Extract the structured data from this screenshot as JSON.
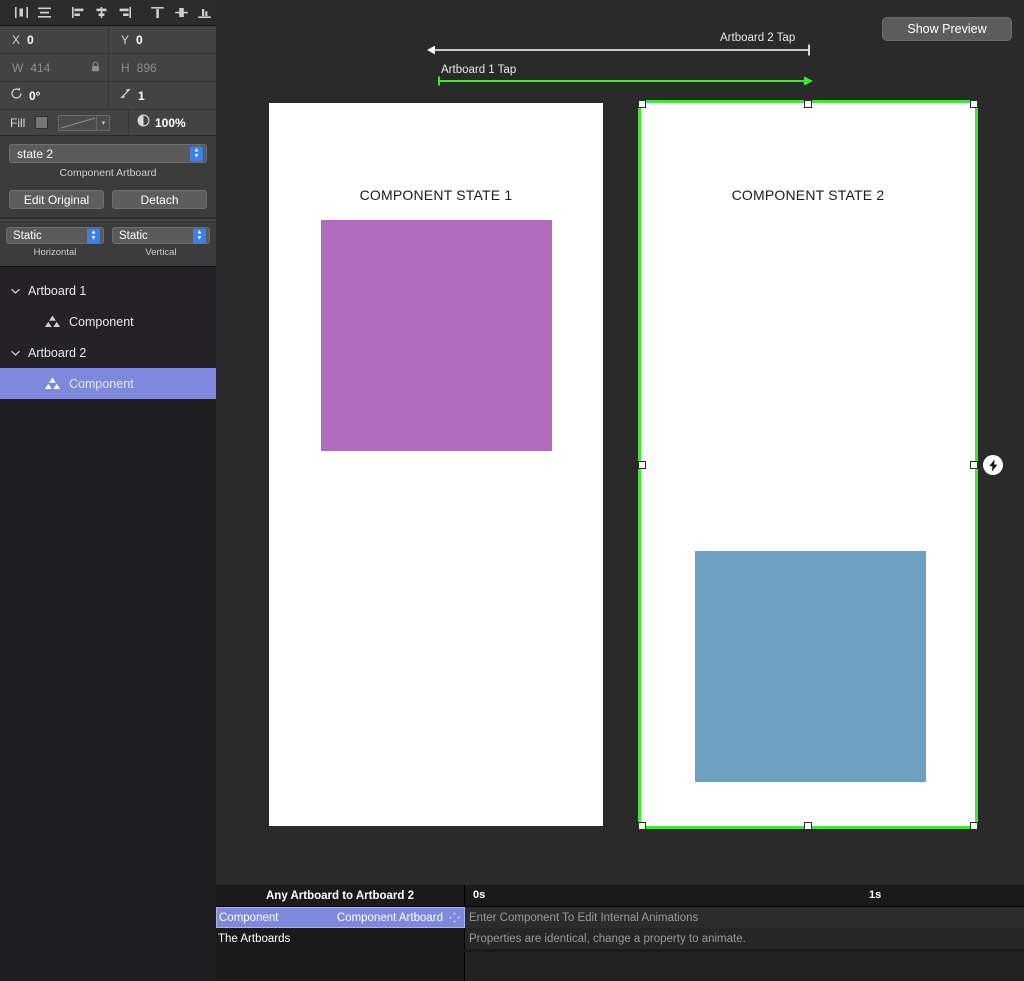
{
  "inspector": {
    "align_tools": [
      {
        "name": "distribute-horizontally-icon",
        "label": "Distribute Horizontally"
      },
      {
        "name": "distribute-vertically-icon",
        "label": "Distribute Vertically"
      },
      {
        "name": "align-left-icon",
        "label": "Align Left"
      },
      {
        "name": "align-center-horizontal-icon",
        "label": "Align Center Horizontal"
      },
      {
        "name": "align-right-icon",
        "label": "Align Right"
      },
      {
        "name": "align-top-icon",
        "label": "Align Top"
      },
      {
        "name": "align-center-vertical-icon",
        "label": "Align Center Vertical"
      },
      {
        "name": "align-bottom-icon",
        "label": "Align Bottom"
      }
    ],
    "x_label": "X",
    "x_value": "0",
    "y_label": "Y",
    "y_value": "0",
    "w_label": "W",
    "w_value": "414",
    "h_label": "H",
    "h_value": "896",
    "rotation_value": "0°",
    "corner_value": "1",
    "fill_label": "Fill",
    "fill_color": "#767676",
    "opacity_value": "100%",
    "state_value": "state 2",
    "state_caption": "Component Artboard",
    "edit_original_label": "Edit Original",
    "detach_label": "Detach",
    "horizontal_value": "Static",
    "horizontal_caption": "Horizontal",
    "vertical_value": "Static",
    "vertical_caption": "Vertical",
    "layers": [
      {
        "label": "Artboard 1",
        "type": "artboard",
        "selected": false
      },
      {
        "label": "Component",
        "type": "component",
        "selected": false
      },
      {
        "label": "Artboard 2",
        "type": "artboard",
        "selected": false
      },
      {
        "label": "Component",
        "type": "component",
        "selected": true
      }
    ]
  },
  "canvas": {
    "preview_button_label": "Show Preview",
    "connections": [
      {
        "label": "Artboard 2 Tap",
        "color": "#ffffff",
        "direction": "left"
      },
      {
        "label": "Artboard 1 Tap",
        "color": "#44e33e",
        "direction": "right"
      }
    ],
    "artboard1": {
      "title": "COMPONENT STATE 1",
      "rect_color": "#b06bbc"
    },
    "artboard2": {
      "title": "COMPONENT STATE 2",
      "rect_color": "#6ea1c0",
      "selection_color": "#44e33e"
    },
    "bolt_badge": "lightning-bolt-icon"
  },
  "timeline": {
    "transition_title": "Any Artboard to Artboard 2",
    "time_start": "0s",
    "time_end": "1s",
    "rows": [
      {
        "name": "Component",
        "sub": "Component Artboard",
        "message": "Enter Component To Edit Internal Animations",
        "selected": true
      },
      {
        "name": "The Artboards",
        "sub": "",
        "message": "Properties are identical, change a property to animate.",
        "selected": false
      }
    ]
  }
}
